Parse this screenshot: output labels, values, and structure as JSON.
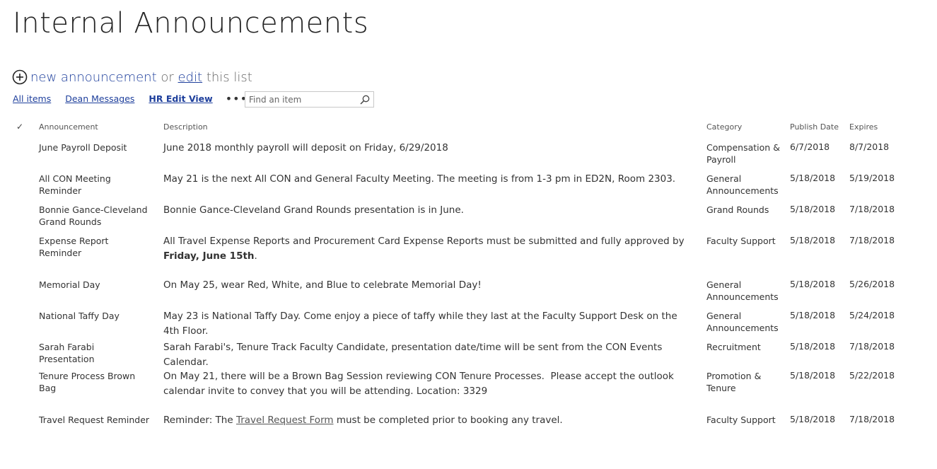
{
  "page": {
    "title": "Internal Announcements"
  },
  "actions": {
    "new_label": "new announcement",
    "or_text": "or",
    "edit_label": "edit",
    "this_list_text": "this list"
  },
  "views": [
    {
      "label": "All items",
      "active": false
    },
    {
      "label": "Dean Messages",
      "active": false
    },
    {
      "label": "HR Edit View",
      "active": true
    }
  ],
  "more_icon": "ellipsis-icon",
  "search": {
    "placeholder": "Find an item",
    "value": "",
    "icon": "search-icon"
  },
  "columns": {
    "check": "✓",
    "announcement": "Announcement",
    "description": "Description",
    "category": "Category",
    "publish_date": "Publish Date",
    "expires": "Expires"
  },
  "rows": [
    {
      "announcement": "June Payroll Deposit",
      "description": "June 2018 monthly payroll will deposit on Friday, 6/29/2018",
      "category": "Compensation & Payroll",
      "publish_date": "6/7/2018",
      "expires": "8/7/2018"
    },
    {
      "announcement": "All CON Meeting Reminder",
      "description": "May 21 is the next All CON and General Faculty Meeting. The meeting is from 1-3 pm in ED2N, Room 2303.",
      "category": "General Announcements",
      "publish_date": "5/18/2018",
      "expires": "5/19/2018"
    },
    {
      "announcement": "Bonnie Gance-Cleveland Grand Rounds",
      "description": "Bonnie Gance-Cleveland Grand Rounds presentation is in June.",
      "category": "Grand Rounds",
      "publish_date": "5/18/2018",
      "expires": "7/18/2018"
    },
    {
      "announcement": "Expense Report Reminder",
      "description_parts": {
        "before": "All Travel Expense Reports and Procurement Card Expense Reports must be submitted and fully approved by ",
        "bold": "Friday, June 15th",
        "after": "."
      },
      "category": "Faculty Support",
      "publish_date": "5/18/2018",
      "expires": "7/18/2018"
    },
    {
      "announcement": "Memorial Day",
      "description": "On May 25, wear Red, White, and Blue to celebrate Memorial Day!",
      "category": "General Announcements",
      "publish_date": "5/18/2018",
      "expires": "5/26/2018"
    },
    {
      "announcement": "National Taffy Day",
      "description": "May 23 is National Taffy Day. Come enjoy a piece of taffy while they last at the Faculty Support Desk on the 4th Floor.",
      "category": "General Announcements",
      "publish_date": "5/18/2018",
      "expires": "5/24/2018"
    },
    {
      "announcement": "Sarah Farabi Presentation",
      "description": "Sarah Farabi's, Tenure Track Faculty Candidate, presentation date/time will be sent from the CON Events Calendar.",
      "category": "Recruitment",
      "publish_date": "5/18/2018",
      "expires": "7/18/2018"
    },
    {
      "announcement": "Tenure Process Brown Bag",
      "description": "On May 21, there will be a Brown Bag Session reviewing CON Tenure Processes.  Please accept the outlook calendar invite to convey that you will be attending. Location: 3329",
      "category": "Promotion & Tenure",
      "publish_date": "5/18/2018",
      "expires": "5/22/2018"
    },
    {
      "announcement": "Travel Request Reminder",
      "description_parts": {
        "before": "Reminder: The ",
        "link": "Travel Request Form",
        "after": " must be completed prior to booking any travel."
      },
      "category": "Faculty Support",
      "publish_date": "5/18/2018",
      "expires": "7/18/2018"
    }
  ]
}
